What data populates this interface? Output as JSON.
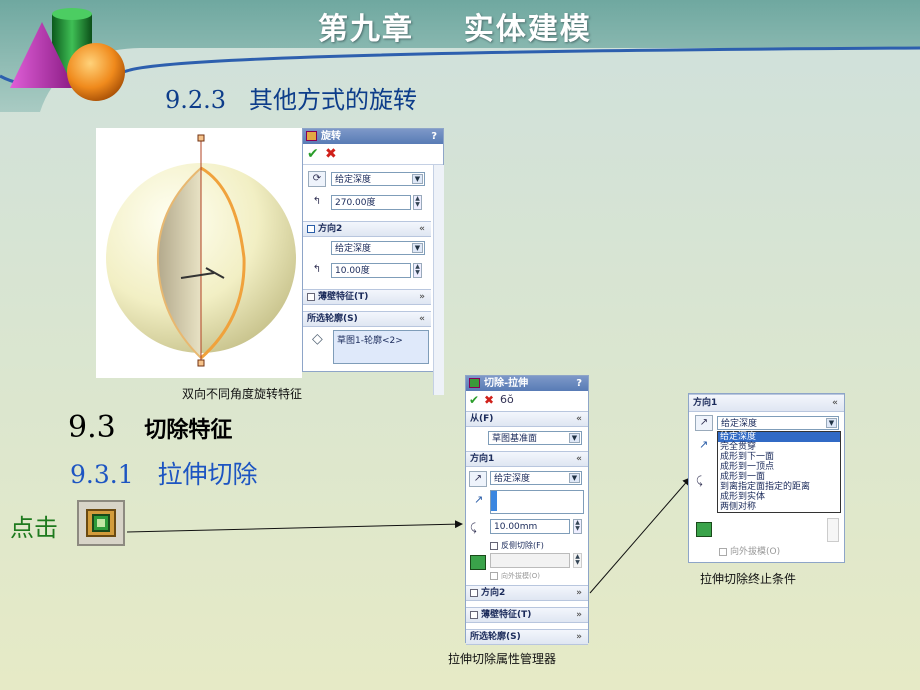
{
  "header": {
    "title": "第九章    实体建模"
  },
  "section_923": "9.2.3   其他方式的旋转",
  "caption_revolve": "双向不同角度旋转特征",
  "section_93": {
    "number": "9.3",
    "title": "切除特征"
  },
  "section_931": "9.3.1   拉伸切除",
  "click_label": "点击",
  "revolve_panel": {
    "title": "旋转",
    "help": "?",
    "direction1_type": "给定深度",
    "direction1_angle": "270.00度",
    "direction2_label": "方向2",
    "direction2_type": "给定深度",
    "direction2_angle": "10.00度",
    "thin_feature_label": "薄壁特征(T)",
    "selected_contours_label": "所选轮廓(S)",
    "contour_item": "草图1-轮廓<2>"
  },
  "cut_extrude_panel": {
    "title": "切除-拉伸",
    "help": "?",
    "from_label": "从(F)",
    "from_value": "草图基准面",
    "direction1_label": "方向1",
    "direction1_type": "给定深度",
    "depth_value": "10.00mm",
    "flip_side_label": "反侧切除(F)",
    "draft_outward_label": "向外拔模(O)",
    "direction2_label": "方向2",
    "thin_feature_label": "薄壁特征(T)",
    "selected_contours_label": "所选轮廓(S)"
  },
  "caption_cut_pm": "拉伸切除属性管理器",
  "end_condition_panel": {
    "direction1_label": "方向1",
    "current_value": "给定深度",
    "options": [
      "给定深度",
      "完全贯穿",
      "成形到下一面",
      "成形到一顶点",
      "成形到一面",
      "到离指定面指定的距离",
      "成形到实体",
      "两侧对称"
    ],
    "selected_index": 0,
    "draft_outward_label": "向外拔模(O)"
  },
  "caption_end_condition": "拉伸切除终止条件",
  "colors": {
    "title_text": "#ffffff",
    "section_heading_blue": "#0d3d8a",
    "subsection_blue": "#1d55c2",
    "click_green": "#1e7a1e",
    "selection_blue": "#316ac5",
    "accept_green": "#2a9d2a",
    "cancel_red": "#d0201a"
  }
}
